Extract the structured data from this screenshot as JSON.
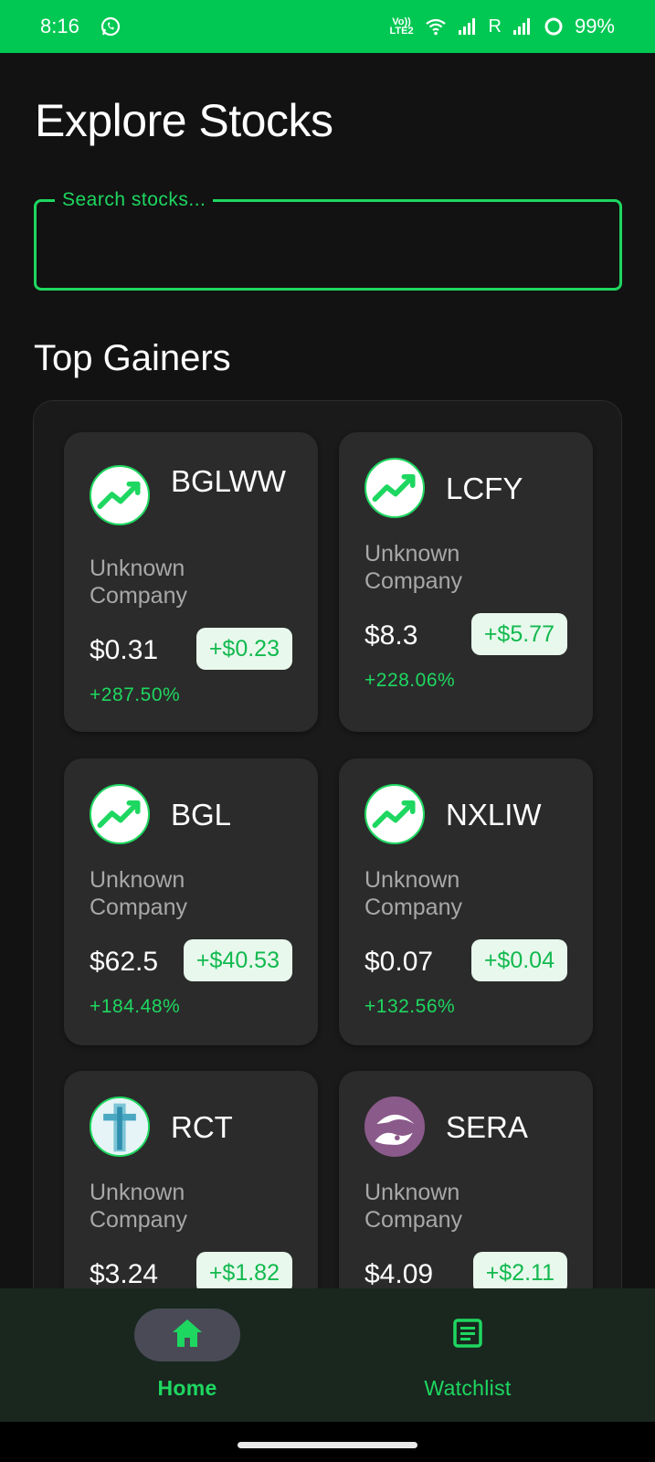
{
  "status_bar": {
    "time": "8:16",
    "network_label": "Vo)) LTE2",
    "roaming": "R",
    "battery": "99%"
  },
  "page": {
    "title": "Explore Stocks",
    "search_placeholder": "Search stocks...",
    "section_title": "Top Gainers"
  },
  "stocks": [
    {
      "symbol": "BGLWW",
      "company": "Unknown Company",
      "price": "$0.31",
      "change": "+$0.23",
      "percent": "+287.50%",
      "logo": "trend-up-icon"
    },
    {
      "symbol": "LCFY",
      "company": "Unknown Company",
      "price": "$8.3",
      "change": "+$5.77",
      "percent": "+228.06%",
      "logo": "trend-up-icon"
    },
    {
      "symbol": "BGL",
      "company": "Unknown Company",
      "price": "$62.5",
      "change": "+$40.53",
      "percent": "+184.48%",
      "logo": "trend-up-icon"
    },
    {
      "symbol": "NXLIW",
      "company": "Unknown Company",
      "price": "$0.07",
      "change": "+$0.04",
      "percent": "+132.56%",
      "logo": "trend-up-icon"
    },
    {
      "symbol": "RCT",
      "company": "Unknown Company",
      "price": "$3.24",
      "change": "+$1.82",
      "percent": "",
      "logo": "rct-logo"
    },
    {
      "symbol": "SERA",
      "company": "Unknown Company",
      "price": "$4.09",
      "change": "+$2.11",
      "percent": "",
      "logo": "sera-logo"
    }
  ],
  "nav": {
    "home": "Home",
    "watchlist": "Watchlist"
  },
  "colors": {
    "accent": "#1ed760",
    "status_bar": "#00c853",
    "background": "#121212",
    "card": "#2b2b2b",
    "nav_background": "#19271f"
  }
}
